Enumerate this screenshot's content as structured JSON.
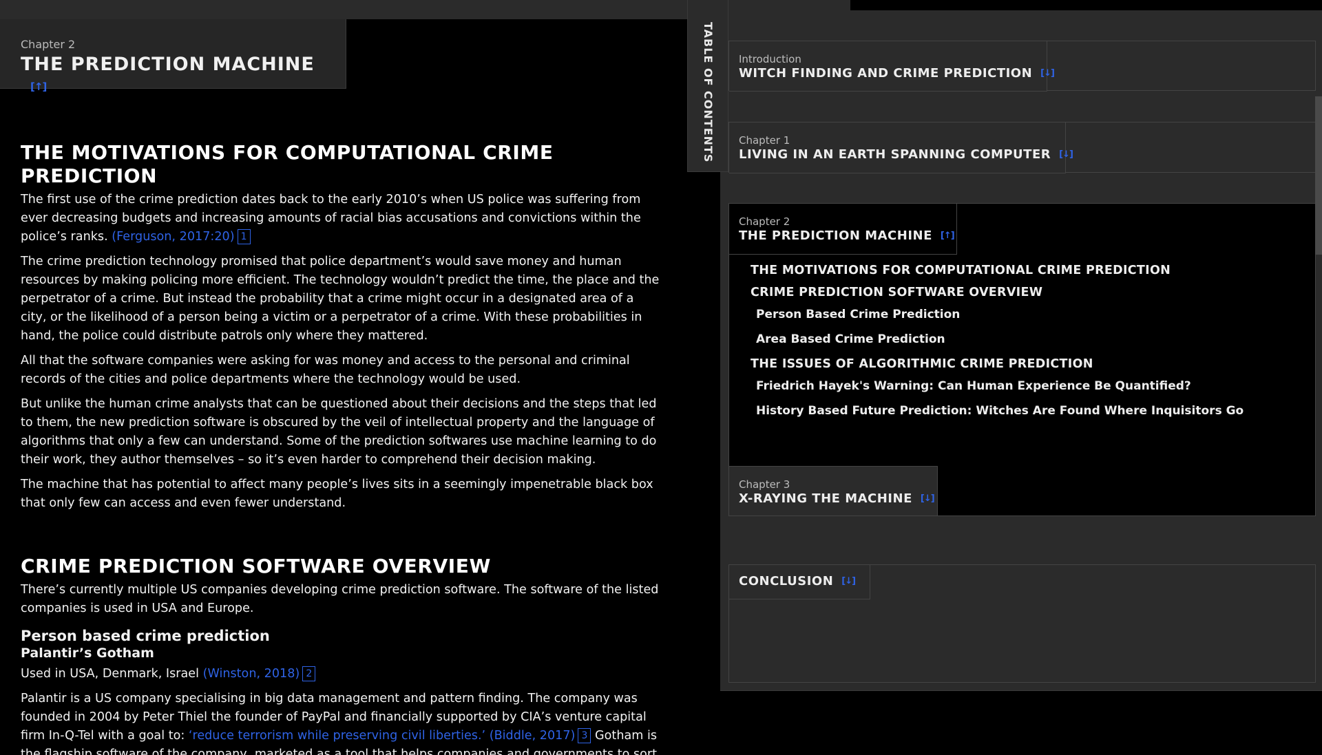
{
  "header": {
    "kicker": "Chapter 2",
    "title": "THE PREDICTION MACHINE",
    "jump_icon": "↑"
  },
  "article": {
    "section1": {
      "heading": "THE MOTIVATIONS FOR COMPUTATIONAL CRIME PREDICTION",
      "p1_text": "The first use of the crime prediction dates back to the early 2010’s when US police was suffering from ever decreasing budgets and increasing amounts of racial bias accusations and convictions within the police’s ranks.",
      "p1_cite": "(Ferguson, 2017:20)",
      "p1_fn": "1",
      "p2": "The crime prediction technology promised that police department’s would save money and human resources by making policing more efficient. The technology wouldn’t predict the time, the place and the perpetrator of a crime. But instead the probability that a crime might occur in a designated area of a city, or the likelihood of a person being a victim or a perpetrator of a crime. With these probabilities in hand, the police could distribute patrols only where they mattered.",
      "p3": "All that the software companies were asking for was money and access to the personal and criminal records of the cities and police departments where the technology would be used.",
      "p4": "But unlike the human crime analysts that can be questioned about their decisions and the steps that led to them, the new prediction software is obscured by the veil of intellectual property and the language of algorithms that only a few can understand. Some of the prediction softwares use machine learning to do their work, they author themselves – so it’s even harder to comprehend their decision making.",
      "p5": "The machine that has potential to affect many people’s lives sits in a seemingly impenetrable black box that only few can access and even fewer understand."
    },
    "section2": {
      "heading": "CRIME PREDICTION SOFTWARE OVERVIEW",
      "p1": "There’s currently multiple US companies developing crime prediction software. The software of the listed companies is used in USA and Europe.",
      "subheading": "Person based crime prediction",
      "product": "Palantir’s Gotham",
      "used_in": "Used in USA, Denmark, Israel",
      "used_cite": "(Winston, 2018)",
      "used_fn": "2",
      "p2_text": "Palantir is a US company specialising in big data management and pattern finding. The company was founded in 2004 by Peter Thiel the founder of PayPal and financially supported by CIA’s venture capital firm In-Q-Tel with a goal to:",
      "p2_quote": "‘reduce terrorism while preserving civil liberties.’ (Biddle, 2017)",
      "p2_fn": "3",
      "p2_after": "Gotham is the flagship software of the company, marketed as a tool that helps companies and governments to sort through vast amounts of various data to unearth insights."
    }
  },
  "toc": {
    "label": "TABLE OF CONTENTS",
    "entries": [
      {
        "kicker": "Introduction",
        "title": "WITCH FINDING AND CRIME PREDICTION",
        "icon": "↓"
      },
      {
        "kicker": "Chapter 1",
        "title": "LIVING IN AN EARTH SPANNING COMPUTER",
        "icon": "↓"
      },
      {
        "kicker": "Chapter 2",
        "title": "THE PREDICTION MACHINE",
        "icon": "↑"
      },
      {
        "kicker": "Chapter 3",
        "title": "X-RAYING THE MACHINE",
        "icon": "↓"
      },
      {
        "kicker": "",
        "title": "CONCLUSION",
        "icon": "↓"
      }
    ],
    "chapter2_subs": [
      "THE MOTIVATIONS FOR COMPUTATIONAL CRIME PREDICTION",
      "CRIME PREDICTION SOFTWARE OVERVIEW",
      "Person Based Crime Prediction",
      "Area Based Crime Prediction",
      "THE ISSUES OF ALGORITHMIC CRIME PREDICTION",
      "Friedrich Hayek's Warning: Can Human Experience Be Quantified?",
      "History Based Future Prediction: Witches Are Found Where Inquisitors Go"
    ]
  }
}
